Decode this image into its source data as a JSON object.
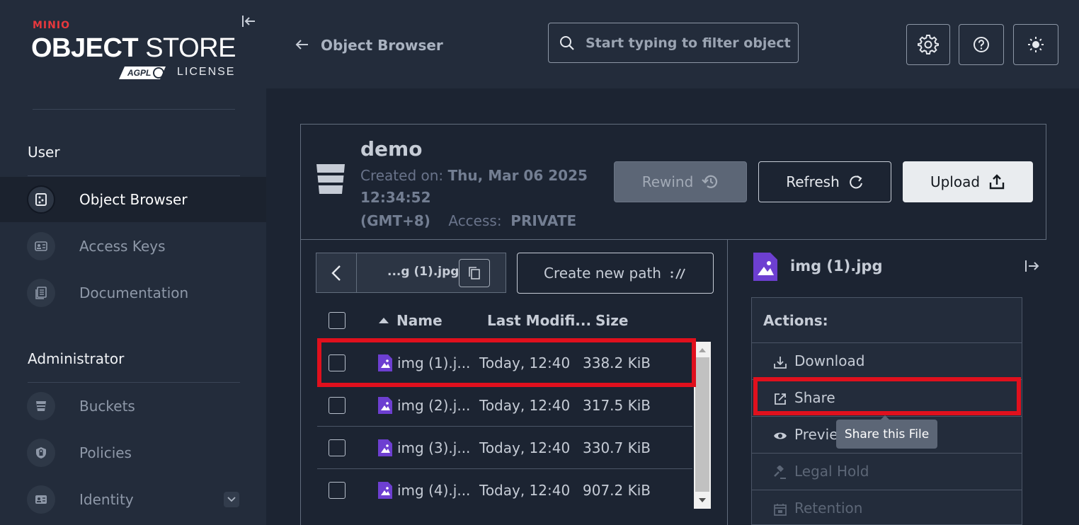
{
  "sidebar": {
    "brand_small": "MINIO",
    "brand_big_bold": "OBJECT",
    "brand_big_light": " STORE",
    "license_label": "LICENSE",
    "user_section": "User",
    "user_items": [
      {
        "label": "Object Browser",
        "icon": "object-browser-icon",
        "active": true
      },
      {
        "label": "Access Keys",
        "icon": "access-keys-icon",
        "active": false
      },
      {
        "label": "Documentation",
        "icon": "documentation-icon",
        "active": false
      }
    ],
    "admin_section": "Administrator",
    "admin_items": [
      {
        "label": "Buckets",
        "icon": "bucket-icon"
      },
      {
        "label": "Policies",
        "icon": "policy-icon"
      },
      {
        "label": "Identity",
        "icon": "identity-icon"
      }
    ]
  },
  "header": {
    "title": "Object Browser",
    "search_placeholder": "Start typing to filter objects in the bucket"
  },
  "bucket": {
    "name": "demo",
    "created_label": "Created on:",
    "created_value_line1": "Thu, Mar 06 2025",
    "created_value_line2": "12:34:52",
    "created_value_tz": "(GMT+8)",
    "access_label": "Access:",
    "access_value": "PRIVATE",
    "rewind_label": "Rewind",
    "refresh_label": "Refresh",
    "upload_label": "Upload"
  },
  "browser": {
    "path": "...g (1).jpg",
    "create_path_label": "Create new path",
    "columns": {
      "name": "Name",
      "modified": "Last Modifi...",
      "size": "Size"
    },
    "rows": [
      {
        "name": "img (1).j...",
        "modified": "Today, 12:40",
        "size": "338.2 KiB"
      },
      {
        "name": "img (2).j...",
        "modified": "Today, 12:40",
        "size": "317.5 KiB"
      },
      {
        "name": "img (3).j...",
        "modified": "Today, 12:40",
        "size": "330.7 KiB"
      },
      {
        "name": "img (4).j...",
        "modified": "Today, 12:40",
        "size": "907.2 KiB"
      }
    ]
  },
  "detail": {
    "file_name": "img (1).jpg",
    "actions_title": "Actions:",
    "actions": [
      {
        "label": "Download",
        "icon": "download-icon",
        "disabled": false
      },
      {
        "label": "Share",
        "icon": "share-icon",
        "disabled": false
      },
      {
        "label": "Previe",
        "icon": "eye-icon",
        "disabled": false
      },
      {
        "label": "Legal Hold",
        "icon": "gavel-icon",
        "disabled": true
      },
      {
        "label": "Retention",
        "icon": "retention-icon",
        "disabled": true
      }
    ],
    "tooltip": "Share this File"
  },
  "colors": {
    "accent_highlight": "#e0101d",
    "file_icon": "#6d3fd1"
  }
}
